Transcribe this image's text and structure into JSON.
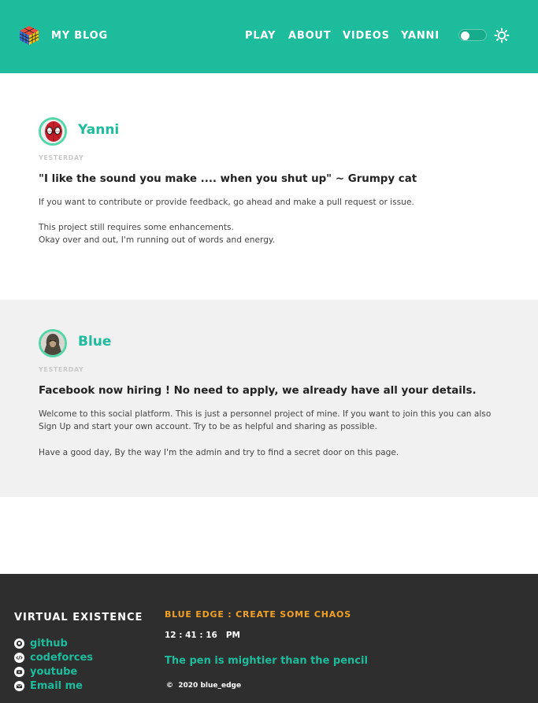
{
  "header": {
    "brand": "MY BLOG",
    "nav": [
      "PLAY",
      "ABOUT",
      "VIDEOS",
      "YANNI"
    ],
    "logo_icon": "rubiks-cube-icon",
    "theme_toggle_icon": "toggle-icon",
    "settings_icon": "sun-icon",
    "bg_color": "#1dbc9c"
  },
  "posts": [
    {
      "author": "Yanni",
      "avatar_icon": "spiderman-avatar",
      "date": "YESTERDAY",
      "title": "\"I like the sound you make .... when you shut up\" ~ Grumpy cat",
      "paragraphs": [
        "If you want to contribute or provide feedback, go ahead and make a pull request or issue.",
        "This project still requires some enhancements.",
        "Okay over and out, I'm running out of words and energy."
      ]
    },
    {
      "author": "Blue",
      "avatar_icon": "hooded-figure-avatar",
      "date": "YESTERDAY",
      "title": "Facebook now hiring ! No need to apply, we already have all your details.",
      "paragraphs": [
        "Welcome to this social platform. This is just a personnel project of mine. If you want to join this you can also Sign Up and start your own account. Try to be as helpful and sharing as possible.",
        "Have a good day, By the way I'm the admin and try to find a secret door on this page."
      ]
    }
  ],
  "footer": {
    "heading": "VIRTUAL EXISTENCE",
    "links": [
      {
        "label": "github",
        "icon": "github-icon"
      },
      {
        "label": "codeforces",
        "icon": "code-icon"
      },
      {
        "label": "youtube",
        "icon": "youtube-icon"
      },
      {
        "label": "Email me",
        "icon": "mail-icon"
      }
    ],
    "tagline": "BLUE EDGE : CREATE SOME CHAOS",
    "clock": "12 : 41 : 16   PM",
    "motto": "The pen is mightier than the pencil",
    "copyright": "©  2020 blue_edge",
    "accent_color": "#f3a125",
    "link_color": "#1dbc9c"
  }
}
